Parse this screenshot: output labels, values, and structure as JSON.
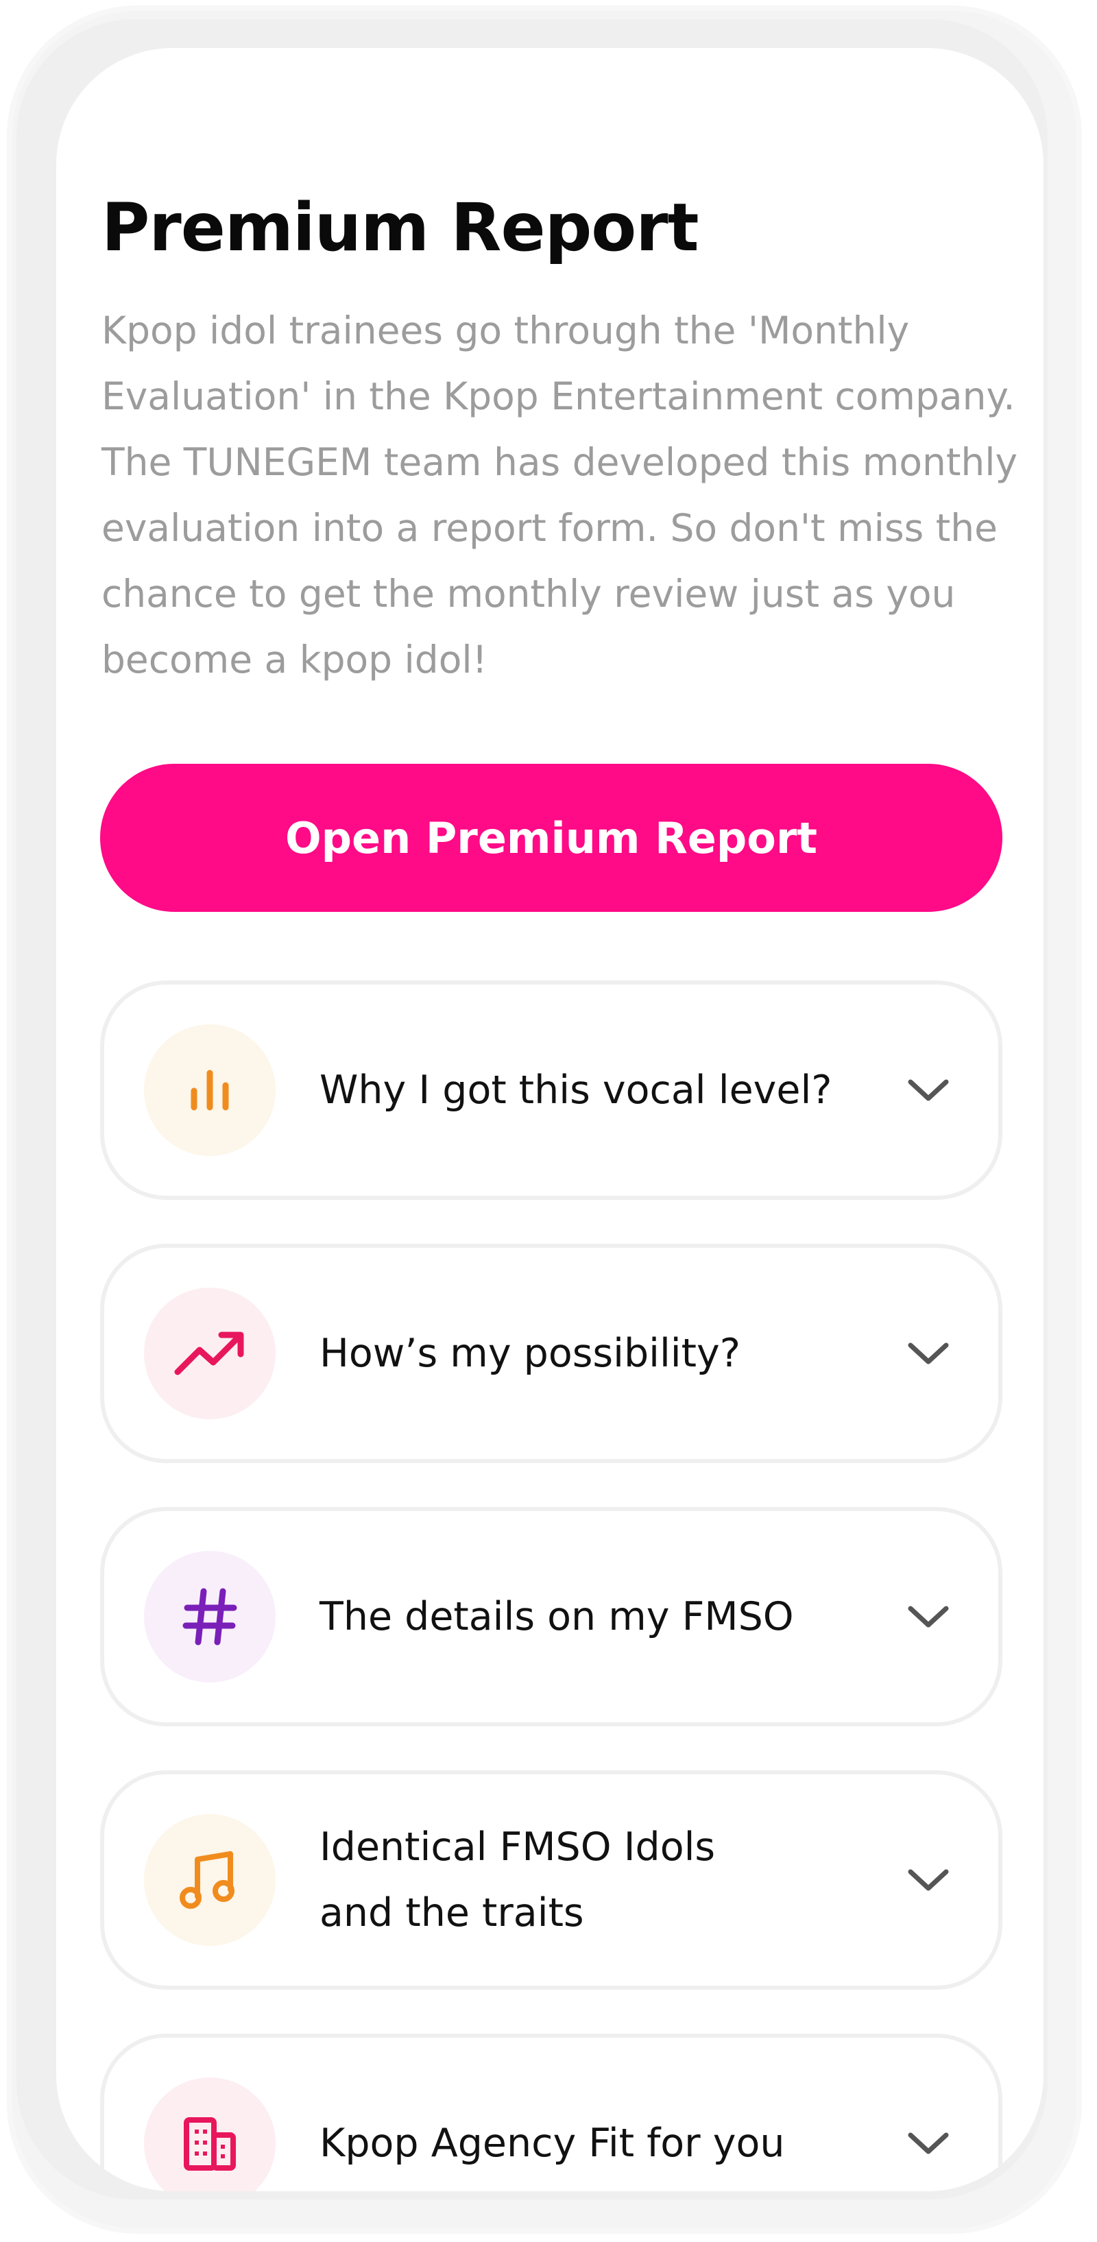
{
  "page": {
    "title": "Premium Report",
    "description": "Kpop idol trainees go through the 'Monthly Evaluation' in the Kpop Entertainment company. The TUNEGEM team has developed this monthly evaluation into a report form. So don't miss the chance to get the monthly review just as you become a kpop idol!",
    "open_button_label": "Open Premium Report"
  },
  "colors": {
    "accent": "#ff0a87",
    "orange": "#f08c1e",
    "pink": "#e8175d",
    "purple": "#7a1fb8"
  },
  "items": [
    {
      "label": "Why I got this vocal level?",
      "icon": "bar-chart-icon"
    },
    {
      "label": "How’s my possibility?",
      "icon": "trending-up-icon"
    },
    {
      "label": "The details on my FMSO",
      "icon": "hashtag-icon"
    },
    {
      "label": "Identical FMSO Idols and the traits",
      "icon": "music-note-icon"
    },
    {
      "label": "Kpop Agency Fit for you",
      "icon": "building-icon"
    }
  ]
}
